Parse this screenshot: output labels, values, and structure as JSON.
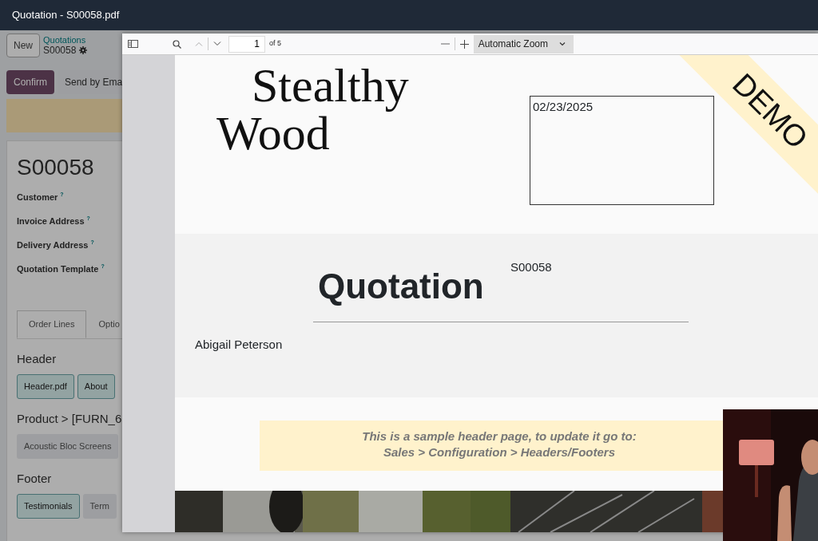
{
  "window": {
    "title": "Quotation - S00058.pdf"
  },
  "form": {
    "new_button": "New",
    "breadcrumb": "Quotations",
    "record": "S00058",
    "actions": [
      {
        "label": "Confirm",
        "primary": true
      },
      {
        "label": "Send by Ema",
        "primary": false
      }
    ],
    "title": "S00058",
    "fields": [
      {
        "label": "Customer",
        "help": "?"
      },
      {
        "label": "Invoice Address",
        "help": "?"
      },
      {
        "label": "Delivery Address",
        "help": "?"
      },
      {
        "label": "Quotation Template",
        "help": "?"
      }
    ],
    "tabs": [
      {
        "label": "Order Lines",
        "selected": true
      },
      {
        "label": "Optio",
        "selected": false
      }
    ],
    "sections": [
      {
        "heading": "Header",
        "tags": [
          {
            "label": "Header.pdf",
            "selected": true
          },
          {
            "label": "About",
            "selected": true
          }
        ]
      },
      {
        "heading": "Product > [FURN_6",
        "tags": [
          {
            "label": "Acoustic Bloc Screens",
            "selected": false
          }
        ]
      },
      {
        "heading": "Footer",
        "tags": [
          {
            "label": "Testimonials",
            "selected": true
          },
          {
            "label": "Term",
            "selected": false
          }
        ]
      }
    ]
  },
  "viewer": {
    "page": "1",
    "page_count": "of 5",
    "zoom": "Automatic Zoom"
  },
  "document": {
    "logo": [
      "Stealthy",
      "Wood"
    ],
    "date": "02/23/2025",
    "ribbon": "DEMO",
    "title": "Quotation",
    "number": "S00058",
    "customer": "Abigail Peterson",
    "notice": [
      "This is a sample header page, to update it go to:",
      "Sales > Configuration > Headers/Footers"
    ]
  }
}
